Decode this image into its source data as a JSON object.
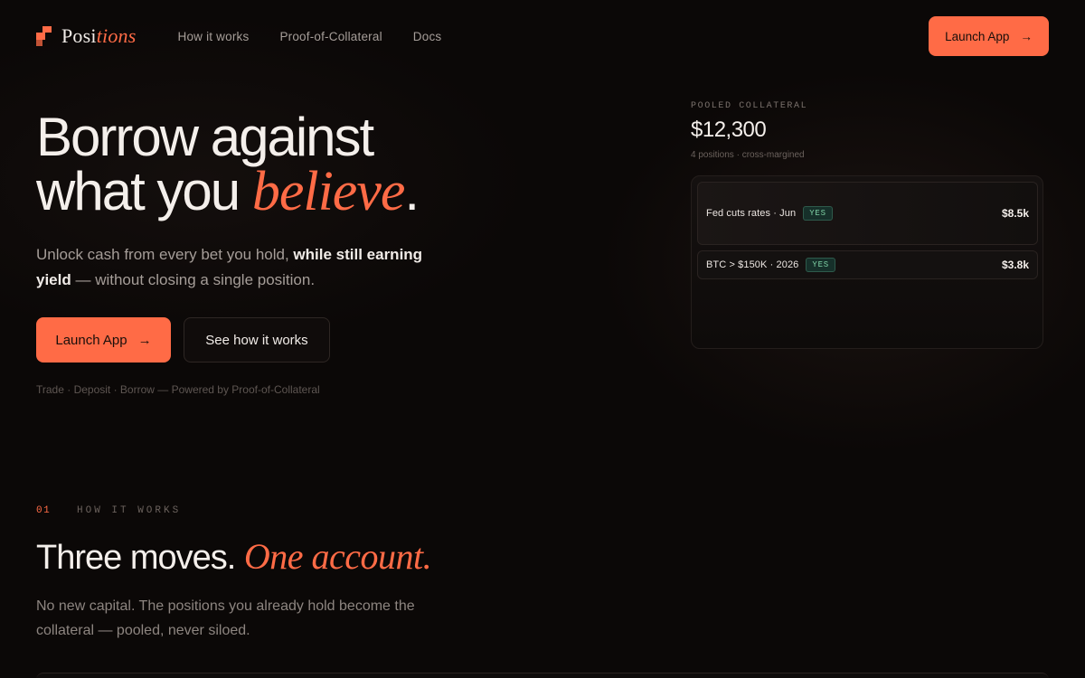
{
  "brand": {
    "name_part1": "Posi",
    "name_part2": "tions",
    "accent": "#ff6b46"
  },
  "nav": {
    "links": [
      "How it works",
      "Proof-of-Collateral",
      "Docs"
    ],
    "launch_label": "Launch App",
    "launch_arrow": "→"
  },
  "hero": {
    "title_line1": "Borrow against",
    "title_line2_prefix": "what you ",
    "title_line2_italic": "believe",
    "title_line2_suffix": ".",
    "subtitle_part1": "Unlock cash from every bet you hold, ",
    "subtitle_bold": "while still earning yield",
    "subtitle_part2": " — without closing a single position.",
    "primary_label": "Launch App",
    "primary_arrow": "→",
    "secondary_label": "See how it works",
    "footnote": "Trade · Deposit · Borrow — Powered by Proof-of-Collateral"
  },
  "collateral": {
    "label": "POOLED COLLATERAL",
    "value": "$12,300",
    "meta": "4 positions · cross-margined",
    "positions": [
      {
        "name": "Fed cuts rates · Jun",
        "badge": "YES",
        "amount": "$8.5k"
      },
      {
        "name": "BTC > $150K · 2026",
        "badge": "YES",
        "amount": "$3.8k"
      }
    ]
  },
  "section": {
    "number": "01",
    "label": "HOW IT WORKS",
    "title_plain": "Three moves. ",
    "title_italic": "One account.",
    "subtitle": "No new capital. The positions you already hold become the collateral — pooled, never siloed."
  }
}
